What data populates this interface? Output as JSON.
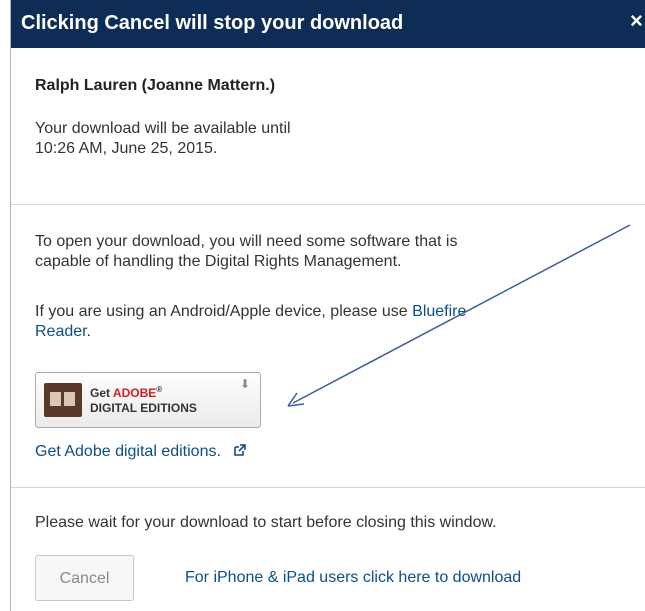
{
  "dialog": {
    "title": "Clicking Cancel will stop your download",
    "close_label": "×"
  },
  "download_info": {
    "book_title": "Ralph Lauren (Joanne Mattern.)",
    "availability_line1": "Your download will be available until",
    "availability_line2": "10:26 AM, June 25, 2015."
  },
  "software": {
    "intro_line1": "To open your download, you will need some software that is",
    "intro_line2": "capable of handling the Digital Rights Management.",
    "device_text": "If you are using an Android/Apple device, please use",
    "bluefire_link_part1": "Bluefire",
    "bluefire_link_part2": "Reader",
    "period": ".",
    "adobe_button": {
      "get": "Get",
      "adobe": "ADOBE",
      "reg": "®",
      "digital_editions": "DIGITAL EDITIONS",
      "download_glyph": "⬇"
    },
    "adobe_link": "Get Adobe digital editions."
  },
  "footer": {
    "wait_text": "Please wait for your download to start before closing this window.",
    "cancel_label": "Cancel",
    "iphone_link": "For iPhone & iPad users click here to download"
  },
  "colors": {
    "header_bg": "#0d2d57",
    "link": "#0f4c8a",
    "arrow": "#3b5b9a"
  }
}
